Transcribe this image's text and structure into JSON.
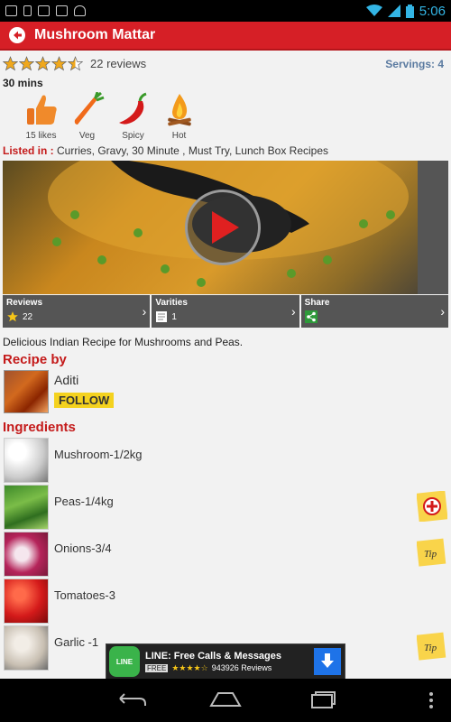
{
  "status": {
    "time": "5:06"
  },
  "header": {
    "title": "Mushroom Mattar"
  },
  "recipe": {
    "rating": 4.5,
    "reviews": "22 reviews",
    "servings": "Servings: 4",
    "time": "30 mins",
    "tags": [
      {
        "label": "15 likes",
        "icon": "thumbs-up-icon"
      },
      {
        "label": "Veg",
        "icon": "carrot-icon"
      },
      {
        "label": "Spicy",
        "icon": "chili-icon"
      },
      {
        "label": "Hot",
        "icon": "fire-icon"
      }
    ],
    "listed_label": "Listed in :",
    "listed_value": " Curries, Gravy, 30 Minute , Must Try, Lunch Box Recipes",
    "info": {
      "reviews_label": "Reviews",
      "reviews_value": "22",
      "varities_label": "Varities",
      "varities_value": "1",
      "share_label": "Share"
    },
    "description": "Delicious Indian Recipe for Mushrooms and Peas.",
    "recipe_by_heading": "Recipe by",
    "author": "Aditi",
    "follow_label": "FOLLOW",
    "ingredients_heading": "Ingredients",
    "ingredients": [
      {
        "name": "Mushroom-1/2kg",
        "action": ""
      },
      {
        "name": "Peas-1/4kg",
        "action": "add"
      },
      {
        "name": "Onions-3/4",
        "action": "tip"
      },
      {
        "name": "Tomatoes-3",
        "action": ""
      },
      {
        "name": "Garlic -1",
        "action": "tip"
      }
    ],
    "tip_label": "Tip"
  },
  "ad": {
    "title": "LINE: Free Calls & Messages",
    "free": "FREE",
    "stars": "★★★★☆",
    "reviews": "943926 Reviews",
    "logo_text": "LINE"
  },
  "colors": {
    "accent": "#d61f26",
    "heading": "#c41a1a",
    "follow": "#f4d21f"
  }
}
